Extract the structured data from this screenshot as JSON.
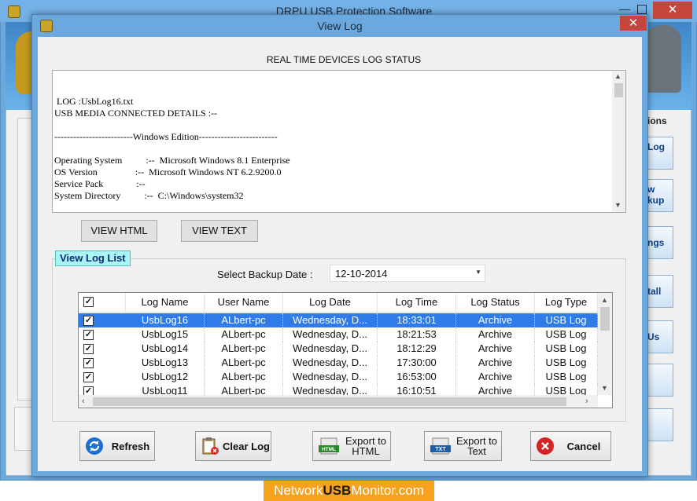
{
  "background_window": {
    "title": "DRPU USB Protection Software",
    "options_label": "ions",
    "side_buttons": [
      "Log",
      "w\nkup",
      "ngs",
      "tall",
      "Us"
    ]
  },
  "dialog": {
    "title": "View Log",
    "close_glyph": "✕",
    "status_heading": "REAL TIME DEVICES  LOG STATUS",
    "log_lines": [
      " LOG :UsbLog16.txt",
      "USB MEDIA CONNECTED DETAILS :--",
      "",
      "-------------------------Windows Edition-------------------------",
      "",
      "Operating System          :--  Microsoft Windows 8.1 Enterprise",
      "OS Version                :--  Microsoft Windows NT 6.2.9200.0",
      "Service Pack              :--",
      "System Directory          :--  C:\\Windows\\system32"
    ],
    "view_html_label": "VIEW HTML",
    "view_text_label": "VIEW  TEXT",
    "list_group_label": "View Log List",
    "backup_date_label": "Select Backup Date :",
    "backup_date_value": "12-10-2014",
    "columns": [
      "Log Name",
      "User Name",
      "Log Date",
      "Log Time",
      "Log Status",
      "Log Type"
    ],
    "rows": [
      {
        "checked": true,
        "selected": true,
        "name": "UsbLog16",
        "user": "ALbert-pc",
        "date": "Wednesday, D...",
        "time": "18:33:01",
        "status": "Archive",
        "type": "USB Log"
      },
      {
        "checked": true,
        "selected": false,
        "name": "UsbLog15",
        "user": "ALbert-pc",
        "date": "Wednesday, D...",
        "time": "18:21:53",
        "status": "Archive",
        "type": "USB Log"
      },
      {
        "checked": true,
        "selected": false,
        "name": "UsbLog14",
        "user": "ALbert-pc",
        "date": "Wednesday, D...",
        "time": "18:12:29",
        "status": "Archive",
        "type": "USB Log"
      },
      {
        "checked": true,
        "selected": false,
        "name": "UsbLog13",
        "user": "ALbert-pc",
        "date": "Wednesday, D...",
        "time": "17:30:00",
        "status": "Archive",
        "type": "USB Log"
      },
      {
        "checked": true,
        "selected": false,
        "name": "UsbLog12",
        "user": "ALbert-pc",
        "date": "Wednesday, D...",
        "time": "16:53:00",
        "status": "Archive",
        "type": "USB Log"
      },
      {
        "checked": true,
        "selected": false,
        "name": "UsbLog11",
        "user": "ALbert-pc",
        "date": "Wednesday, D...",
        "time": "16:10:51",
        "status": "Archive",
        "type": "USB Log"
      }
    ],
    "buttons": {
      "refresh": "Refresh",
      "clear_log": "Clear Log",
      "export_html": "Export to\nHTML",
      "export_text": "Export to\nText",
      "cancel": "Cancel"
    },
    "icons": {
      "refresh": "refresh-icon",
      "clear_log": "clipboard-delete-icon",
      "export_html": "html-file-icon",
      "export_text": "txt-file-icon",
      "cancel": "red-x-icon"
    }
  },
  "footer": {
    "brand_prefix": "Network",
    "brand_bold": "USB",
    "brand_suffix": "Monitor.com"
  },
  "colors": {
    "selection": "#2f7be8",
    "list_label_bg": "#a9f5f6",
    "footer_bg": "#f6a21d",
    "close_red": "#c7453a"
  }
}
